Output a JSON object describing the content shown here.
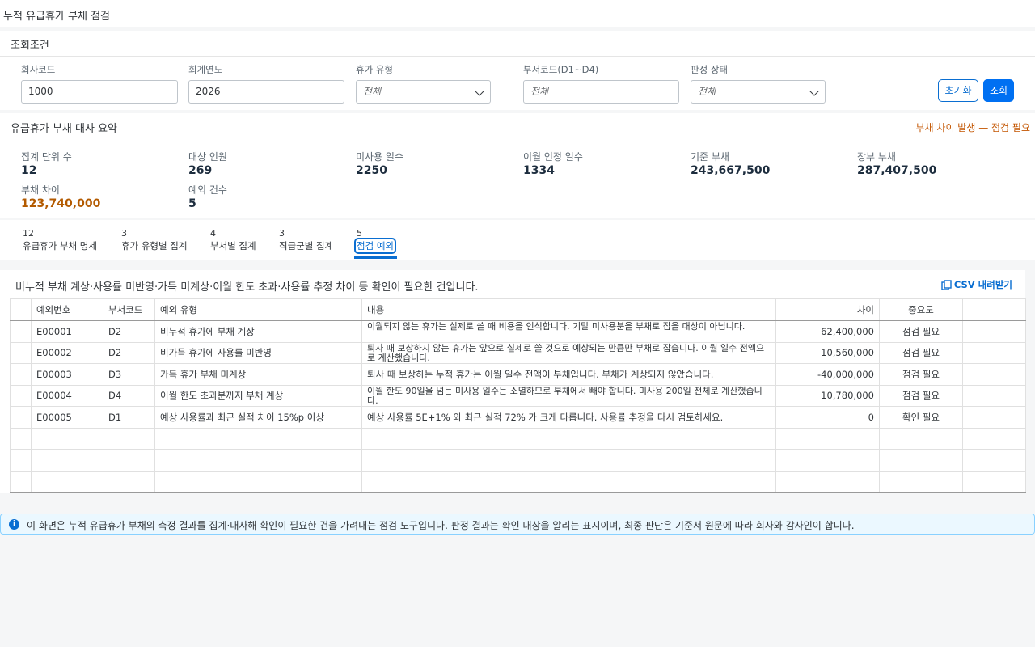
{
  "page": {
    "title": "누적 유급휴가 부채 점검"
  },
  "filters": {
    "title": "조회조건",
    "company_code": {
      "label": "회사코드",
      "value": "1000"
    },
    "fiscal_year": {
      "label": "회계연도",
      "value": "2026"
    },
    "leave_type": {
      "label": "휴가 유형",
      "value": "전체"
    },
    "dept_code": {
      "label": "부서코드(D1~D4)",
      "placeholder": "전체"
    },
    "judgment": {
      "label": "판정 상태",
      "value": "전체"
    },
    "reset_label": "초기화",
    "search_label": "조회"
  },
  "summary": {
    "title": "유급휴가 부채 대사 요약",
    "alert": "부채 차이 발생 — 점검 필요",
    "kpis": [
      {
        "label": "집계 단위 수",
        "value": "12"
      },
      {
        "label": "대상 인원",
        "value": "269"
      },
      {
        "label": "미사용 일수",
        "value": "2250"
      },
      {
        "label": "이월 인정 일수",
        "value": "1334"
      },
      {
        "label": "기준 부채",
        "value": "243,667,500"
      },
      {
        "label": "장부 부채",
        "value": "287,407,500"
      },
      {
        "label": "부채 차이",
        "value": "123,740,000"
      },
      {
        "label": "예외 건수",
        "value": "5"
      }
    ]
  },
  "tabs": [
    {
      "count": "12",
      "label": "유급휴가 부채 명세"
    },
    {
      "count": "3",
      "label": "휴가 유형별 집계"
    },
    {
      "count": "4",
      "label": "부서별 집계"
    },
    {
      "count": "3",
      "label": "직급군별 집계"
    },
    {
      "count": "5",
      "label": "점검 예외"
    }
  ],
  "exceptions": {
    "description": "비누적 부채 계상·사용률 미반영·가득 미계상·이월 한도 초과·사용률 추정 차이 등 확인이 필요한 건입니다.",
    "csv_label": "CSV 내려받기",
    "columns": [
      "예외번호",
      "부서코드",
      "예외 유형",
      "내용",
      "차이",
      "중요도"
    ],
    "rows": [
      {
        "id": "E00001",
        "dept": "D2",
        "type": "비누적 휴가에 부채 계상",
        "detail": "이월되지 않는 휴가는 실제로 쓸 때 비용을 인식합니다. 기말 미사용분을 부채로 잡을 대상이 아닙니다.",
        "diff": "62,400,000",
        "severity": "점검 필요"
      },
      {
        "id": "E00002",
        "dept": "D2",
        "type": "비가득 휴가에 사용률 미반영",
        "detail": "퇴사 때 보상하지 않는 휴가는 앞으로 실제로 쓸 것으로 예상되는 만큼만 부채로 잡습니다. 이월 일수 전액으로 계산했습니다.",
        "diff": "10,560,000",
        "severity": "점검 필요"
      },
      {
        "id": "E00003",
        "dept": "D3",
        "type": "가득 휴가 부채 미계상",
        "detail": "퇴사 때 보상하는 누적 휴가는 이월 일수 전액이 부채입니다. 부채가 계상되지 않았습니다.",
        "diff": "-40,000,000",
        "severity": "점검 필요"
      },
      {
        "id": "E00004",
        "dept": "D4",
        "type": "이월 한도 초과분까지 부채 계상",
        "detail": "이월 한도 90일을 넘는 미사용 일수는 소멸하므로 부채에서 빼야 합니다. 미사용 200일 전체로 계산했습니다.",
        "diff": "10,780,000",
        "severity": "점검 필요"
      },
      {
        "id": "E00005",
        "dept": "D1",
        "type": "예상 사용률과 최근 실적 차이 15%p 이상",
        "detail": "예상 사용률 5E+1% 와 최근 실적 72% 가 크게 다릅니다. 사용률 추정을 다시 검토하세요.",
        "diff": "0",
        "severity": "확인 필요"
      }
    ]
  },
  "info": "이 화면은 누적 유급휴가 부채의 측정 결과를 집계·대사해 확인이 필요한 건을 가려내는 점검 도구입니다. 판정 결과는 확인 대상을 알리는 표시이며, 최종 판단은 기준서 원문에 따라 회사와 감사인이 합니다."
}
